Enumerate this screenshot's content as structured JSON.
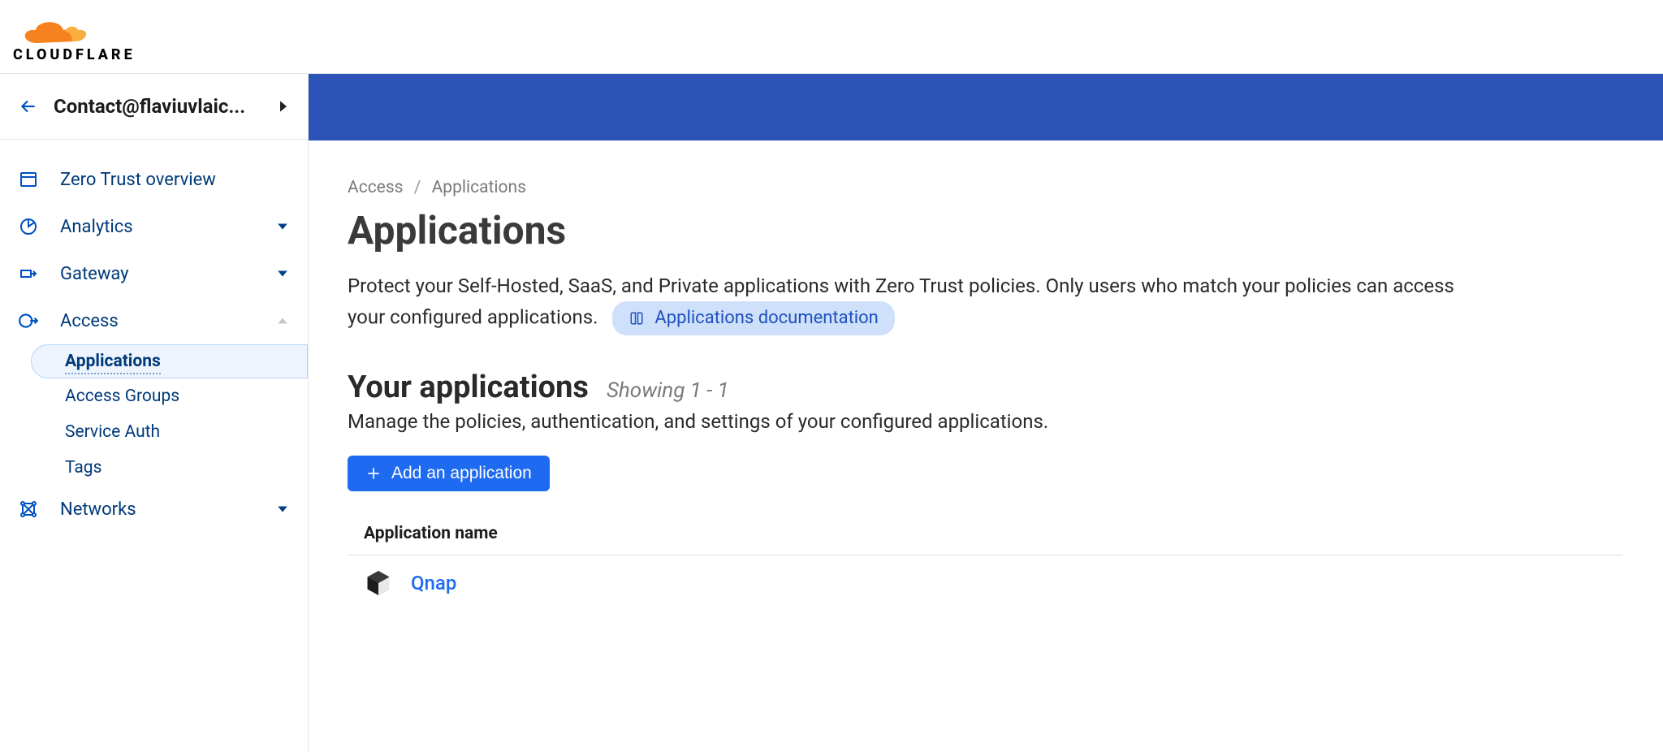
{
  "brand": {
    "name": "CLOUDFLARE"
  },
  "account": {
    "name": "Contact@flaviuvlaic..."
  },
  "sidebar": {
    "items": [
      {
        "label": "Zero Trust overview",
        "expandable": false
      },
      {
        "label": "Analytics",
        "expandable": true
      },
      {
        "label": "Gateway",
        "expandable": true
      },
      {
        "label": "Access",
        "expandable": true,
        "expanded": true
      },
      {
        "label": "Networks",
        "expandable": true
      }
    ],
    "access_sub": [
      {
        "label": "Applications",
        "active": true
      },
      {
        "label": "Access Groups"
      },
      {
        "label": "Service Auth"
      },
      {
        "label": "Tags"
      }
    ]
  },
  "breadcrumb": {
    "parent": "Access",
    "current": "Applications"
  },
  "page": {
    "title": "Applications",
    "description": "Protect your Self-Hosted, SaaS, and Private applications with Zero Trust policies. Only users who match your policies can access your configured applications.",
    "doc_link_label": "Applications documentation"
  },
  "section": {
    "title": "Your applications",
    "showing": "Showing 1 - 1",
    "description": "Manage the policies, authentication, and settings of your configured applications.",
    "add_button": "Add an application"
  },
  "table": {
    "header": "Application name",
    "rows": [
      {
        "name": "Qnap"
      }
    ]
  }
}
